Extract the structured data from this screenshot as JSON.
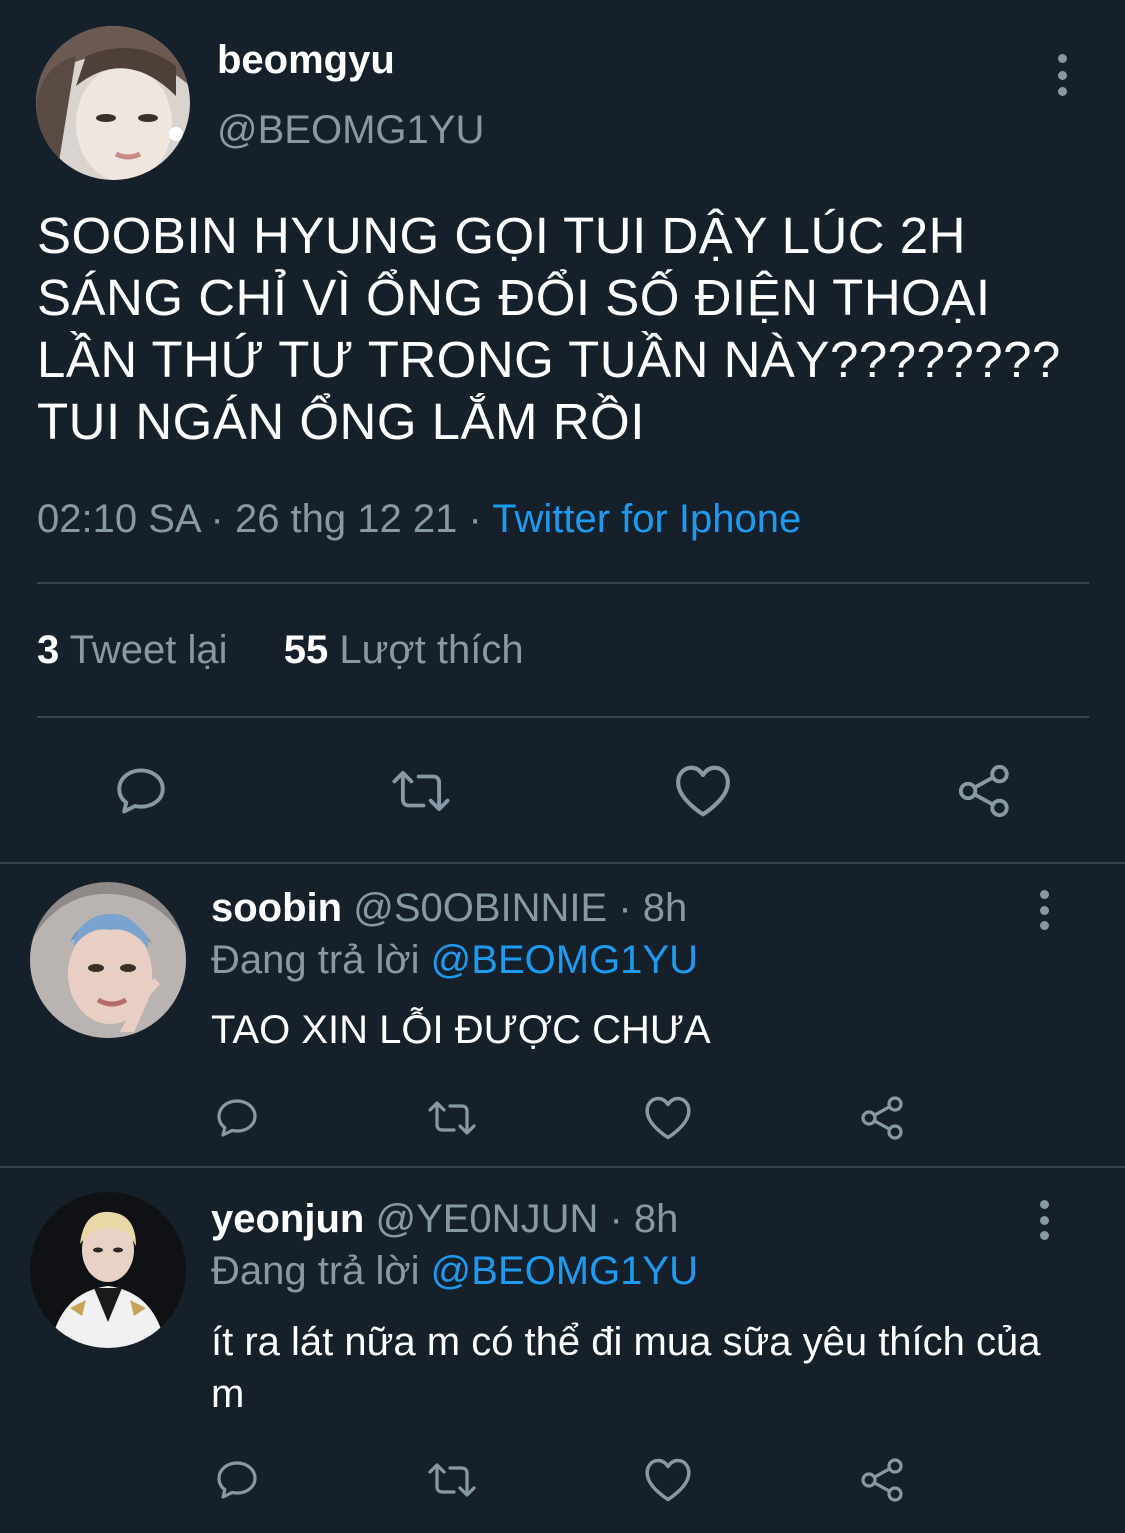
{
  "main_tweet": {
    "name": "beomgyu",
    "handle": "@BEOMG1YU",
    "text_lines": [
      "SOOBIN HYUNG GỌI TUI DẬY LÚC 2H",
      "SÁNG CHỈ VÌ ỔNG ĐỔI SỐ ĐIỆN THOẠI",
      "LẦN THỨ TƯ TRONG TUẦN NÀY????????",
      "TUI NGÁN ỔNG LẮM RỒI"
    ],
    "time": "02:10 SA",
    "date": "26 thg 12 21",
    "separator": "·",
    "source": "Twitter for Iphone",
    "retweet_count": "3",
    "retweet_label": "Tweet lại",
    "like_count": "55",
    "like_label": "Lượt thích"
  },
  "replies": [
    {
      "name": "soobin",
      "handle": "@S0OBINNIE",
      "time": "· 8h",
      "replying_label": "Đang trả lời",
      "replying_to": "@BEOMG1YU",
      "text": "TAO XIN LỖI ĐƯỢC CHƯA"
    },
    {
      "name": "yeonjun",
      "handle": "@YE0NJUN",
      "time": "· 8h",
      "replying_label": "Đang trả lời",
      "replying_to": "@BEOMG1YU",
      "text": "ít ra lát nữa m có thể đi mua sữa yêu thích của m"
    }
  ],
  "icons": {
    "more": "more-vertical-icon",
    "reply": "reply-icon",
    "retweet": "retweet-icon",
    "like": "heart-icon",
    "share": "share-icon"
  },
  "colors": {
    "background": "#15202b",
    "text": "#ffffff",
    "muted": "#8899a6",
    "link": "#1d9bf0",
    "divider": "#38444d"
  }
}
